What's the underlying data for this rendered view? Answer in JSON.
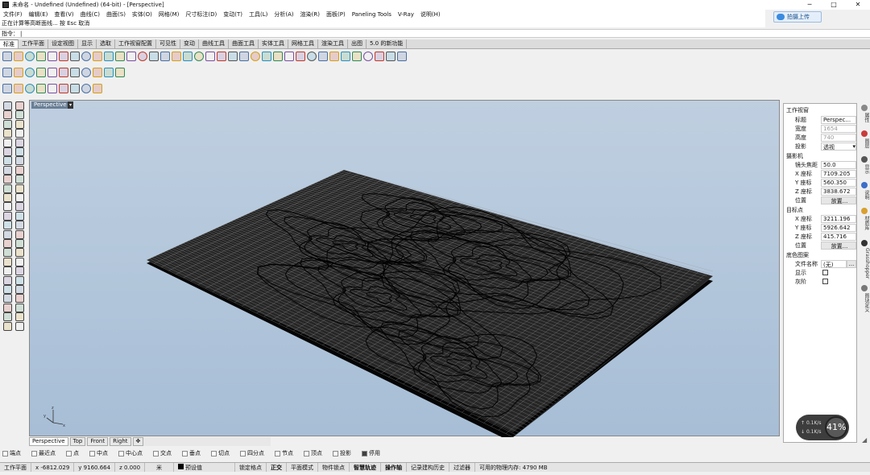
{
  "window": {
    "title": "未命名 - Undefined (Undefined) (64-bit) - [Perspective]",
    "minimize": "─",
    "maximize": "□",
    "close": "✕"
  },
  "cloud_button": {
    "label": "拍摄上传"
  },
  "menu": [
    "文件(F)",
    "编辑(E)",
    "查看(V)",
    "曲线(C)",
    "曲面(S)",
    "实体(O)",
    "网格(M)",
    "尺寸标注(D)",
    "变动(T)",
    "工具(L)",
    "分析(A)",
    "渲染(R)",
    "面板(P)",
    "Paneling Tools",
    "V-Ray",
    "说明(H)"
  ],
  "command": {
    "history": "正在计算等高断面线... 按 Esc 取消",
    "prompt": "指令："
  },
  "tabs": [
    "标准",
    "工作平面",
    "设定视图",
    "显示",
    "选取",
    "工作视窗配置",
    "可见性",
    "变动",
    "曲线工具",
    "曲面工具",
    "实体工具",
    "网格工具",
    "渲染工具",
    "出图",
    "5.0 的新功能"
  ],
  "viewport": {
    "name": "Perspective",
    "axes": {
      "x": "x",
      "y": "y",
      "z": "z"
    }
  },
  "view_tabs": [
    "Perspective",
    "Top",
    "Front",
    "Right",
    "✥"
  ],
  "osnaps": [
    {
      "label": "端点",
      "on": false
    },
    {
      "label": "最近点",
      "on": false
    },
    {
      "label": "点",
      "on": false
    },
    {
      "label": "中点",
      "on": false
    },
    {
      "label": "中心点",
      "on": false
    },
    {
      "label": "交点",
      "on": false
    },
    {
      "label": "垂点",
      "on": false
    },
    {
      "label": "切点",
      "on": false
    },
    {
      "label": "四分点",
      "on": false
    },
    {
      "label": "节点",
      "on": false
    },
    {
      "label": "顶点",
      "on": false
    },
    {
      "label": "投影",
      "on": false
    },
    {
      "label": "停用",
      "on": true
    }
  ],
  "status": {
    "cplane": "工作平面",
    "x": "x -6812.029",
    "y": "y 9160.664",
    "z": "z 0.000",
    "unit": "米",
    "layer": "预设值",
    "toggles": [
      "锁定格点",
      "正交",
      "平面模式",
      "物件锁点",
      "智慧轨迹",
      "操作轴",
      "记录建构历史",
      "过滤器"
    ],
    "bold_toggles": [
      "正交",
      "智慧轨迹",
      "操作轴"
    ],
    "memory": "可用的物理内存: 4790 MB"
  },
  "properties": {
    "sec_view": "工作视窗",
    "title_label": "标题",
    "title_value": "Perspec...",
    "width_label": "宽度",
    "width_value": "1654",
    "height_label": "高度",
    "height_value": "740",
    "proj_label": "投影",
    "proj_value": "透视",
    "sec_camera": "摄影机",
    "lens_label": "镜头焦距",
    "lens_value": "50.0",
    "cx_label": "X 座标",
    "cx_value": "7109.205",
    "cy_label": "Y 座标",
    "cy_value": "560.350",
    "cz_label": "Z 座标",
    "cz_value": "3838.672",
    "cpos_label": "位置",
    "cpos_btn": "放置...",
    "sec_target": "目标点",
    "tx_label": "X 座标",
    "tx_value": "3211.196",
    "ty_label": "Y 座标",
    "ty_value": "5926.642",
    "tz_label": "Z 座标",
    "tz_value": "415.716",
    "tpos_label": "位置",
    "tpos_btn": "放置...",
    "sec_wallpaper": "底色图案",
    "file_label": "文件名称",
    "file_value": "(无)",
    "file_btn": "...",
    "show_label": "显示",
    "gray_label": "灰阶"
  },
  "side_tabs": [
    "属性",
    "图层",
    "显示",
    "说明",
    "材质库",
    "Grasshopper",
    "图块定义"
  ],
  "net": {
    "percent": "41%",
    "up": "0.1K/s",
    "down": "0.1K/s"
  },
  "colors": {
    "viewport_top": "#bfcfe0",
    "viewport_bottom": "#a7bed6",
    "terrain_fill": "#262626",
    "terrain_base": "#050505",
    "mesh_line": "#9a9a9a",
    "contour": "#000000"
  }
}
